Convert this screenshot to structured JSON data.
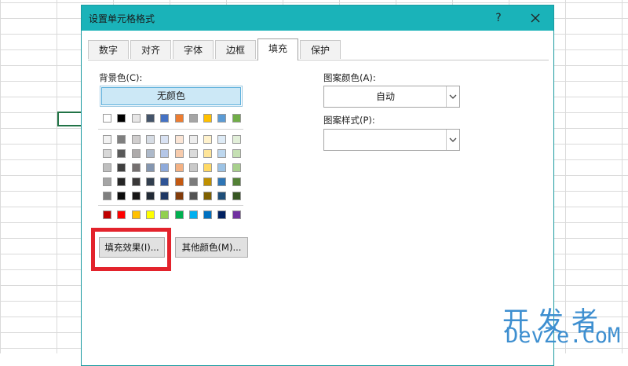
{
  "dialog": {
    "title": "设置单元格格式",
    "help_label": "?",
    "tabs": [
      {
        "label": "数字"
      },
      {
        "label": "对齐"
      },
      {
        "label": "字体"
      },
      {
        "label": "边框"
      },
      {
        "label": "填充",
        "active": true
      },
      {
        "label": "保护"
      }
    ],
    "background_color_label": "背景色(C):",
    "no_color_label": "无颜色",
    "fill_effects_label": "填充效果(I)...",
    "more_colors_label": "其他颜色(M)...",
    "pattern_color_label": "图案颜色(A):",
    "pattern_color_value": "自动",
    "pattern_style_label": "图案样式(P):",
    "pattern_style_value": ""
  },
  "palette": {
    "theme_top": [
      "#ffffff",
      "#000000",
      "#e7e6e6",
      "#44546a",
      "#4472c4",
      "#ed7d31",
      "#a5a5a5",
      "#ffc000",
      "#5b9bd5",
      "#70ad47"
    ],
    "theme_shades": [
      [
        "#f2f2f2",
        "#7f7f7f",
        "#d0cece",
        "#d6dce4",
        "#d9e2f3",
        "#fbe5d5",
        "#ededed",
        "#fff2cc",
        "#deebf6",
        "#e2efd9"
      ],
      [
        "#d8d8d8",
        "#595959",
        "#aeabab",
        "#adb9ca",
        "#b4c6e7",
        "#f7cbac",
        "#dbdbdb",
        "#fee599",
        "#bdd7ee",
        "#c5e0b3"
      ],
      [
        "#bfbfbf",
        "#3f3f3f",
        "#757070",
        "#8496b0",
        "#8eaadb",
        "#f4b183",
        "#c9c9c9",
        "#ffd965",
        "#9cc3e5",
        "#a8d08d"
      ],
      [
        "#a5a5a5",
        "#262626",
        "#3a3838",
        "#323f4f",
        "#2f5496",
        "#c45911",
        "#7b7b7b",
        "#bf9000",
        "#2e75b5",
        "#538135"
      ],
      [
        "#7f7f7f",
        "#0c0c0c",
        "#171616",
        "#222a35",
        "#1f3864",
        "#833c0b",
        "#525252",
        "#7f6000",
        "#1e4e79",
        "#375623"
      ]
    ],
    "standard": [
      "#c00000",
      "#ff0000",
      "#ffc000",
      "#ffff00",
      "#92d050",
      "#00b050",
      "#00b0f0",
      "#0070c0",
      "#002060",
      "#7030a0"
    ]
  },
  "watermark": {
    "cn": "开发者",
    "en": "DevZe.CoM"
  },
  "colors": {
    "titlebar": "#1ab3b9",
    "highlight": "#e3232c",
    "selected_fill": "#cce8f6"
  }
}
